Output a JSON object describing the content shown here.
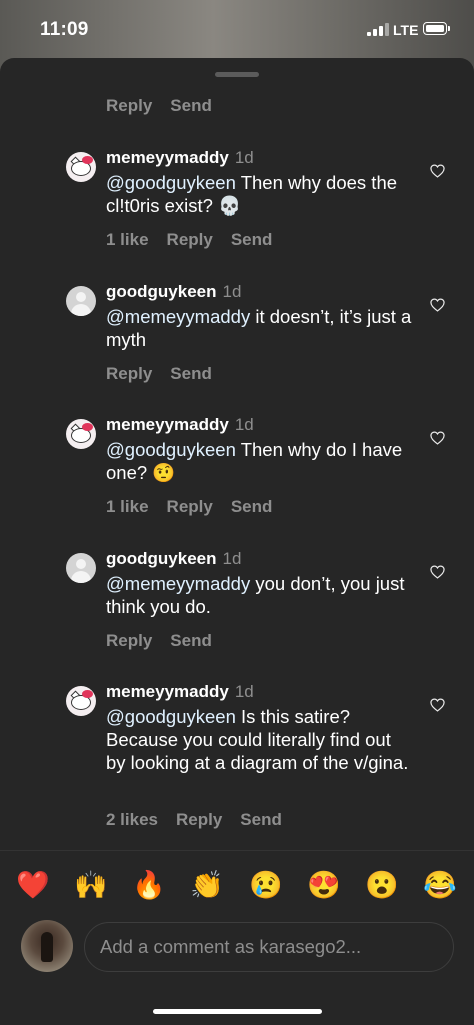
{
  "status": {
    "time": "11:09",
    "network": "LTE"
  },
  "top_actions": {
    "reply": "Reply",
    "send": "Send"
  },
  "comments": [
    {
      "username": "memeyymaddy",
      "age": "1d",
      "mention": "@goodguykeen",
      "text": " Then why does the cl!t0ris exist? 💀",
      "likes": "1 like",
      "reply": "Reply",
      "send": "Send",
      "avatar": "hello-kitty-avatar"
    },
    {
      "username": "goodguykeen",
      "age": "1d",
      "mention": "@memeyymaddy",
      "text": " it doesn’t, it’s just a myth",
      "likes": "",
      "reply": "Reply",
      "send": "Send",
      "avatar": "default-avatar"
    },
    {
      "username": "memeyymaddy",
      "age": "1d",
      "mention": "@goodguykeen",
      "text": " Then why do I have one? 🤨",
      "likes": "1 like",
      "reply": "Reply",
      "send": "Send",
      "avatar": "hello-kitty-avatar"
    },
    {
      "username": "goodguykeen",
      "age": "1d",
      "mention": "@memeyymaddy",
      "text": " you don’t, you just think you do.",
      "likes": "",
      "reply": "Reply",
      "send": "Send",
      "avatar": "default-avatar"
    },
    {
      "username": "memeyymaddy",
      "age": "1d",
      "mention": "@goodguykeen",
      "text": " Is this satire? Because you could literally find out by looking  at a diagram of the v/gina.",
      "likes": "2 likes",
      "reply": "Reply",
      "send": "Send",
      "avatar": "hello-kitty-avatar"
    }
  ],
  "emoji_bar": [
    "❤️",
    "🙌",
    "🔥",
    "👏",
    "😢",
    "😍",
    "😮",
    "😂"
  ],
  "comment_input": {
    "placeholder": "Add a comment as karasego2..."
  },
  "colors": {
    "background": "#262626",
    "secondary_text": "#8e8e8e",
    "mention": "#e0f1ff"
  }
}
